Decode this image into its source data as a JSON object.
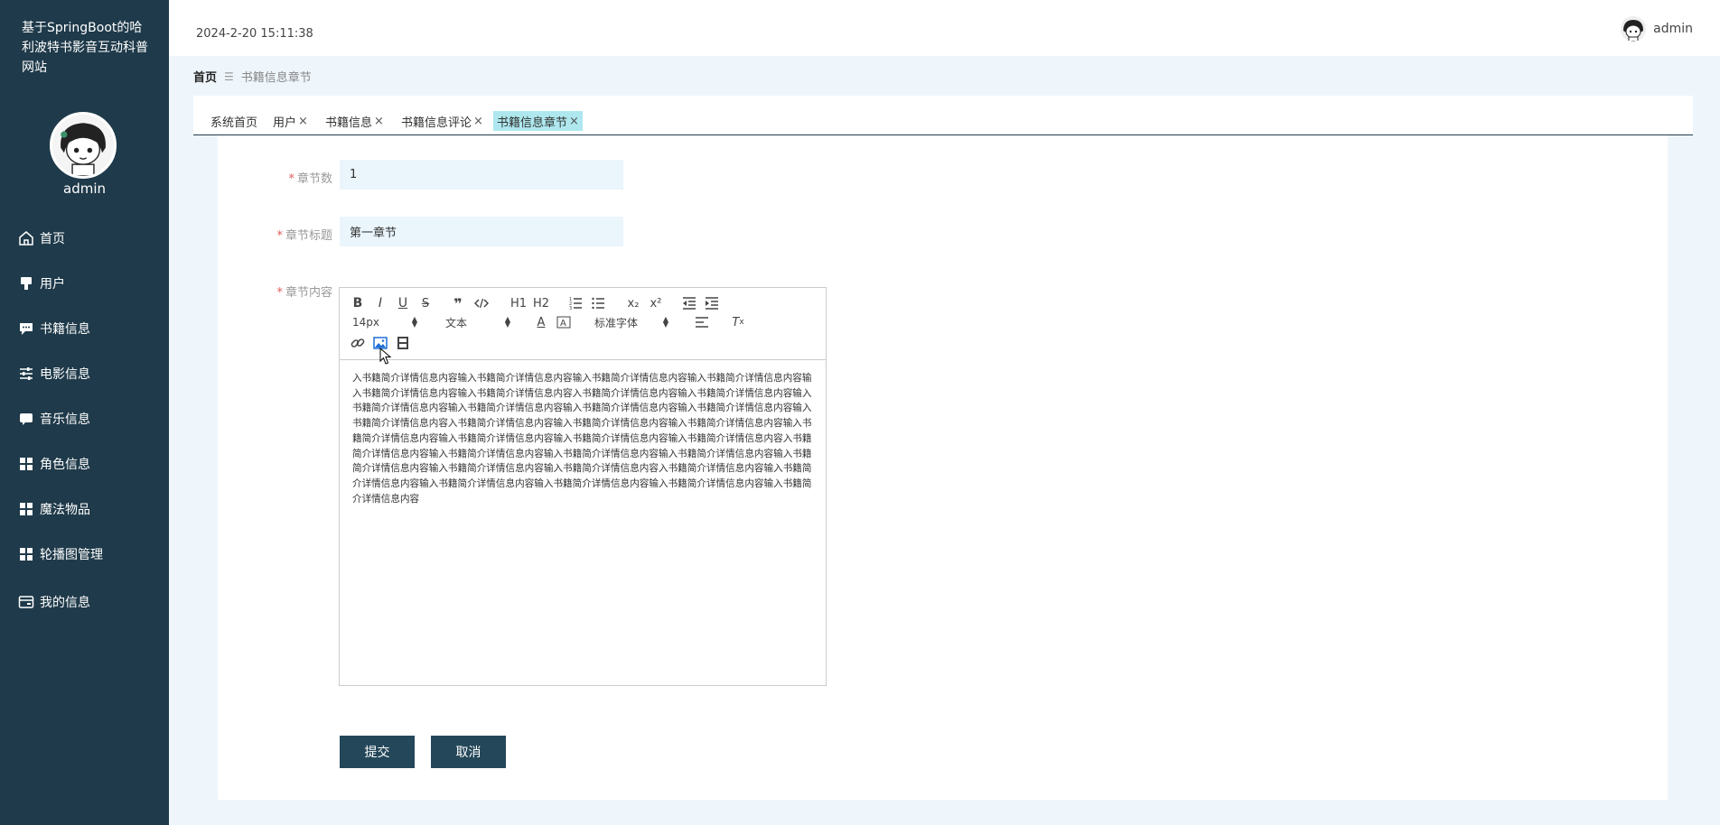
{
  "sidebar": {
    "site_title": "基于SpringBoot的哈利波特书影音互动科普网站",
    "username": "admin",
    "items": [
      {
        "label": "首页",
        "icon": "home-icon"
      },
      {
        "label": "用户",
        "icon": "user-icon"
      },
      {
        "label": "书籍信息",
        "icon": "comment-icon"
      },
      {
        "label": "电影信息",
        "icon": "sliders-icon"
      },
      {
        "label": "音乐信息",
        "icon": "chat-icon"
      },
      {
        "label": "角色信息",
        "icon": "grid-icon"
      },
      {
        "label": "魔法物品",
        "icon": "grid-icon"
      },
      {
        "label": "轮播图管理",
        "icon": "grid-icon"
      },
      {
        "label": "我的信息",
        "icon": "card-icon"
      }
    ]
  },
  "header": {
    "datetime": "2024-2-20 15:11:38",
    "username": "admin"
  },
  "breadcrumb": {
    "home": "首页",
    "separator": "☰",
    "current": "书籍信息章节"
  },
  "tabs": [
    {
      "label": "系统首页",
      "closable": false,
      "active": false
    },
    {
      "label": "用户",
      "closable": true,
      "active": false
    },
    {
      "label": "书籍信息",
      "closable": true,
      "active": false
    },
    {
      "label": "书籍信息评论",
      "closable": true,
      "active": false
    },
    {
      "label": "书籍信息章节",
      "closable": true,
      "active": true
    }
  ],
  "tab_close": "×",
  "form": {
    "required_mark": "*",
    "chapter_num": {
      "label": "章节数",
      "value": "1"
    },
    "chapter_title": {
      "label": "章节标题",
      "value": "第一章节"
    },
    "chapter_content": {
      "label": "章节内容",
      "text": "入书籍简介详情信息内容输入书籍简介详情信息内容输入书籍简介详情信息内容输入书籍简介详情信息内容输入书籍简介详情信息内容输入书籍简介详情信息内容入书籍简介详情信息内容输入书籍简介详情信息内容输入书籍简介详情信息内容输入书籍简介详情信息内容输入书籍简介详情信息内容输入书籍简介详情信息内容输入书籍简介详情信息内容入书籍简介详情信息内容输入书籍简介详情信息内容输入书籍简介详情信息内容输入书籍简介详情信息内容输入书籍简介详情信息内容输入书籍简介详情信息内容输入书籍简介详情信息内容入书籍简介详情信息内容输入书籍简介详情信息内容输入书籍简介详情信息内容输入书籍简介详情信息内容输入书籍简介详情信息内容输入书籍简介详情信息内容输入书籍简介详情信息内容入书籍简介详情信息内容输入书籍简介详情信息内容输入书籍简介详情信息内容输入书籍简介详情信息内容输入书籍简介详情信息内容输入书籍简介详情信息内容"
    }
  },
  "editor_toolbar": {
    "font_size": "14px",
    "header_type": "文本",
    "font_family": "标准字体",
    "h1": "H1",
    "h2": "H2",
    "sub": "x₂",
    "sup": "x²"
  },
  "buttons": {
    "submit": "提交",
    "cancel": "取消"
  }
}
